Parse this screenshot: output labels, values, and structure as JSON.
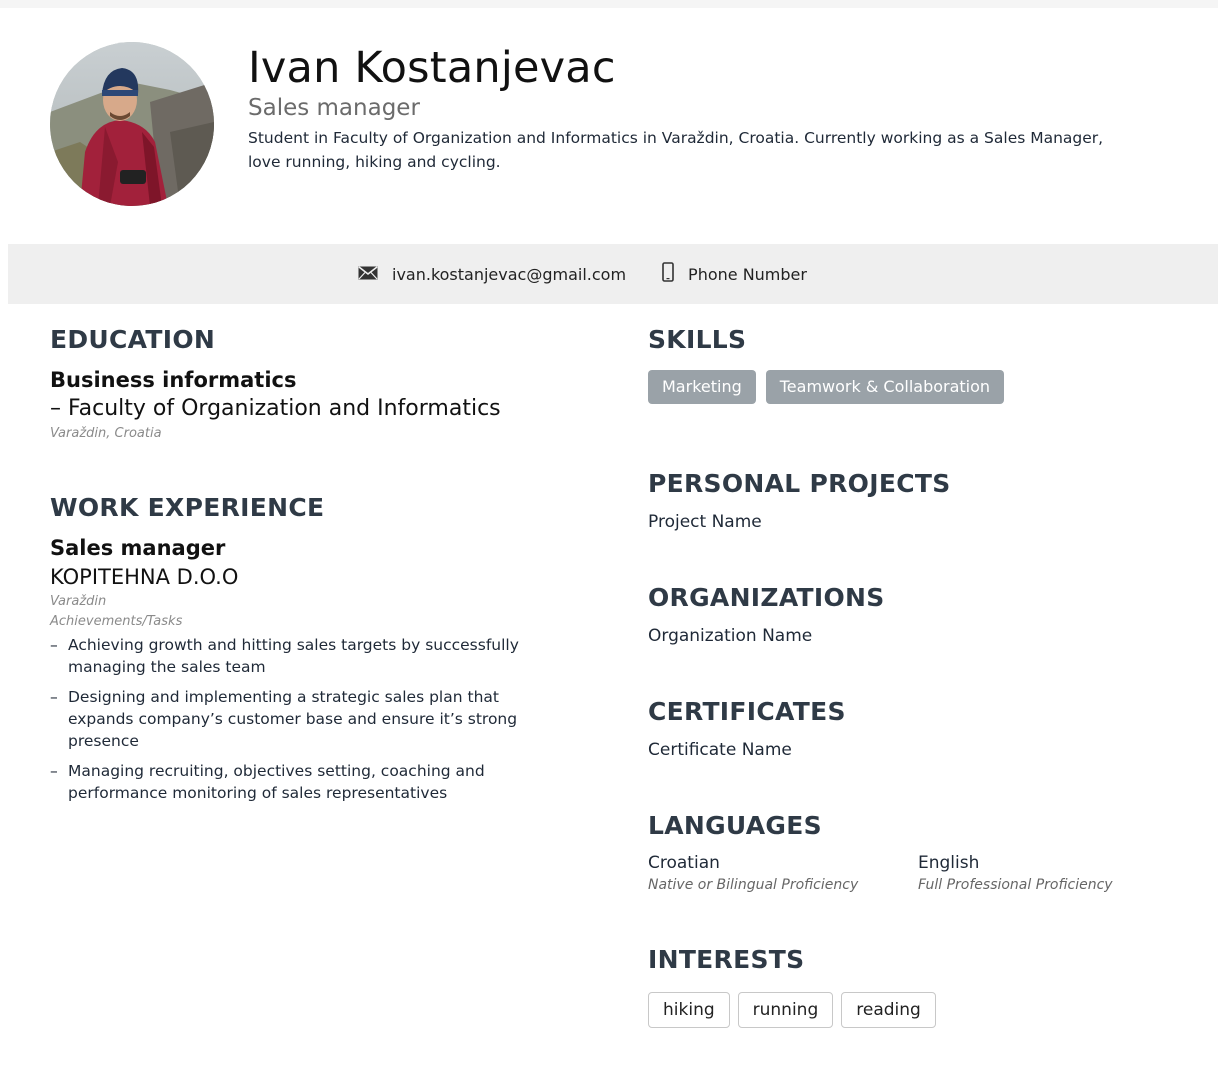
{
  "header": {
    "name": "Ivan Kostanjevac",
    "role": "Sales manager",
    "summary": "Student in Faculty of Organization and Informatics in Varaždin, Croatia. Currently working as a Sales Manager, love running, hiking and cycling."
  },
  "contact": {
    "email": "ivan.kostanjevac@gmail.com",
    "email_icon": "envelope-icon",
    "phone": "Phone Number",
    "phone_icon": "mobile-phone-icon"
  },
  "education": {
    "title": "EDUCATION",
    "degree": "Business informatics",
    "school": "– Faculty of Organization and Informatics",
    "location": "Varaždin, Croatia"
  },
  "work": {
    "title": "WORK EXPERIENCE",
    "job_title": "Sales manager",
    "company": "KOPITEHNA D.O.O",
    "location": "Varaždin",
    "tasks_label": "Achievements/Tasks",
    "bullets": [
      "Achieving growth and hitting sales targets by successfully managing the sales team",
      "Designing and implementing a strategic sales plan that expands company’s customer base and ensure it’s strong presence",
      "Managing recruiting, objectives setting, coaching and performance monitoring of sales representatives"
    ],
    "bullet_marker": "–"
  },
  "skills": {
    "title": "SKILLS",
    "items": [
      "Marketing",
      "Teamwork & Collaboration"
    ]
  },
  "projects": {
    "title": "PERSONAL PROJECTS",
    "value": "Project Name"
  },
  "organizations": {
    "title": "ORGANIZATIONS",
    "value": "Organization Name"
  },
  "certificates": {
    "title": "CERTIFICATES",
    "value": "Certificate Name"
  },
  "languages": {
    "title": "LANGUAGES",
    "items": [
      {
        "name": "Croatian",
        "level": "Native or Bilingual Proficiency"
      },
      {
        "name": "English",
        "level": "Full Professional Proficiency"
      }
    ]
  },
  "interests": {
    "title": "INTERESTS",
    "items": [
      "hiking",
      "running",
      "reading"
    ]
  },
  "colors": {
    "section_title": "#2f3a46",
    "skill_tag_bg": "#9aa2a8",
    "contact_bar_bg": "#efefef"
  }
}
